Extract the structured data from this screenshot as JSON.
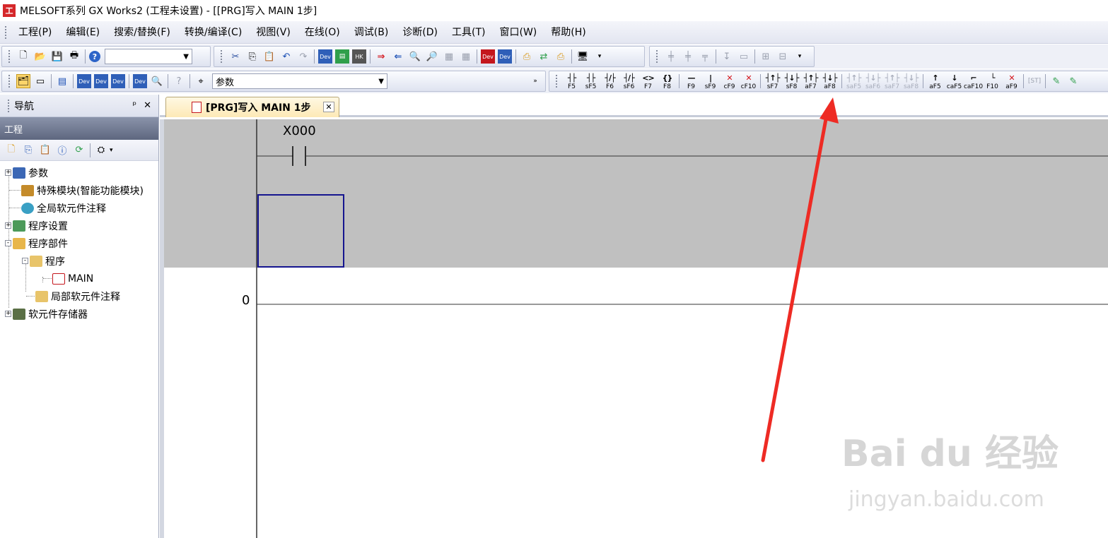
{
  "window": {
    "title": "MELSOFT系列 GX Works2 (工程未设置) - [[PRG]写入 MAIN 1步]"
  },
  "menu": [
    "工程(P)",
    "编辑(E)",
    "搜索/替换(F)",
    "转换/编译(C)",
    "视图(V)",
    "在线(O)",
    "调试(B)",
    "诊断(D)",
    "工具(T)",
    "窗口(W)",
    "帮助(H)"
  ],
  "toolbar": {
    "combo1_value": "",
    "combo2_value": "参数",
    "ladder_keys": [
      {
        "sym": "┤├",
        "key": "F5"
      },
      {
        "sym": "┤├",
        "key": "sF5"
      },
      {
        "sym": "┤/├",
        "key": "F6"
      },
      {
        "sym": "┤/├",
        "key": "sF6"
      },
      {
        "sym": "<>",
        "key": "F7"
      },
      {
        "sym": "{}",
        "key": "F8"
      },
      {
        "sym": "—",
        "key": "F9"
      },
      {
        "sym": "|",
        "key": "sF9"
      },
      {
        "sym": "✕",
        "key": "cF9"
      },
      {
        "sym": "✕",
        "key": "cF10"
      },
      {
        "sym": "┤↑├",
        "key": "sF7"
      },
      {
        "sym": "┤↓├",
        "key": "sF8"
      },
      {
        "sym": "┤↑├",
        "key": "aF7"
      },
      {
        "sym": "┤↓├",
        "key": "aF8"
      },
      {
        "sym": "┤↑├",
        "key": "saF5"
      },
      {
        "sym": "┤↓├",
        "key": "saF6"
      },
      {
        "sym": "┤↑├",
        "key": "saF7"
      },
      {
        "sym": "┤↓├",
        "key": "saF8"
      },
      {
        "sym": "↑",
        "key": "aF5"
      },
      {
        "sym": "↓",
        "key": "caF5"
      },
      {
        "sym": "⌐",
        "key": "caF10"
      },
      {
        "sym": "└",
        "key": "F10"
      },
      {
        "sym": "✕",
        "key": "aF9"
      }
    ]
  },
  "navigator": {
    "title": "导航",
    "pin": "ᵖ",
    "close": "✕",
    "section": "工程",
    "tree": [
      {
        "label": "参数",
        "expander": "+"
      },
      {
        "label": "特殊模块(智能功能模块)",
        "expander": ""
      },
      {
        "label": "全局软元件注释",
        "expander": ""
      },
      {
        "label": "程序设置",
        "expander": "+"
      },
      {
        "label": "程序部件",
        "expander": "-"
      },
      {
        "label": "程序",
        "expander": "-"
      },
      {
        "label": "MAIN",
        "expander": ""
      },
      {
        "label": "局部软元件注释",
        "expander": ""
      },
      {
        "label": "软元件存储器",
        "expander": "+"
      }
    ]
  },
  "tab": {
    "label": "[PRG]写入 MAIN 1步",
    "close": "✕"
  },
  "ladder": {
    "contact_label": "X000",
    "step_number": "0"
  },
  "watermark": {
    "logo": "Bai du 经验",
    "url": "jingyan.baidu.com"
  }
}
